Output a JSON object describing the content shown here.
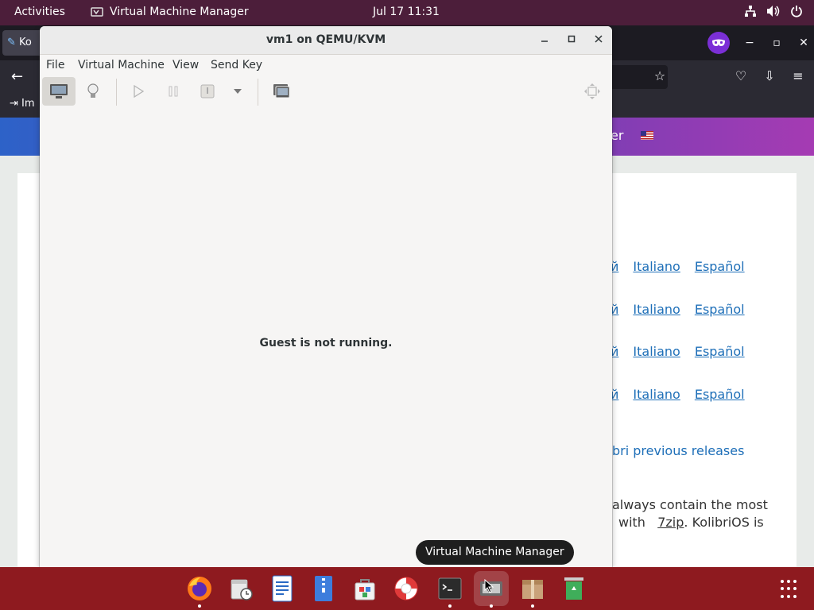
{
  "topbar": {
    "activities": "Activities",
    "app_name": "Virtual Machine Manager",
    "clock": "Jul 17  11:31"
  },
  "browser": {
    "tab_label": "Ko",
    "bookmark_label": "Im",
    "nav_fragment": "er",
    "lang_rows": [
      {
        "frag": "й",
        "it": "Italiano",
        "es": "Español"
      },
      {
        "frag": "й",
        "it": "Italiano",
        "es": "Español"
      },
      {
        "frag": "й",
        "it": "Italiano",
        "es": "Español"
      },
      {
        "frag": "й",
        "it": "Italiano",
        "es": "Español"
      }
    ],
    "previous_releases": "bri previous releases",
    "para_line1": "always contain the most",
    "para_line2_a": "with",
    "para_line2_link": "7zip",
    "para_line2_b": ".  KolibriOS  is"
  },
  "vm_window": {
    "title": "vm1 on QEMU/KVM",
    "menu": {
      "file": "File",
      "virtual_machine": "Virtual Machine",
      "view": "View",
      "send_key": "Send Key"
    },
    "status_message": "Guest is not running."
  },
  "tooltip": "Virtual Machine Manager",
  "icons": {
    "network": "network-icon",
    "volume": "volume-icon",
    "power": "power-icon",
    "console": "monitor-icon",
    "details": "lightbulb-icon",
    "run": "play-icon",
    "pause": "pause-icon",
    "shutdown": "power-button-icon",
    "snapshots": "snapshots-icon",
    "fullscreen": "fullscreen-icon"
  },
  "colors": {
    "topbar": "#4c1e3a",
    "dock": "#8e1a1f",
    "link": "#1e6fb8"
  }
}
